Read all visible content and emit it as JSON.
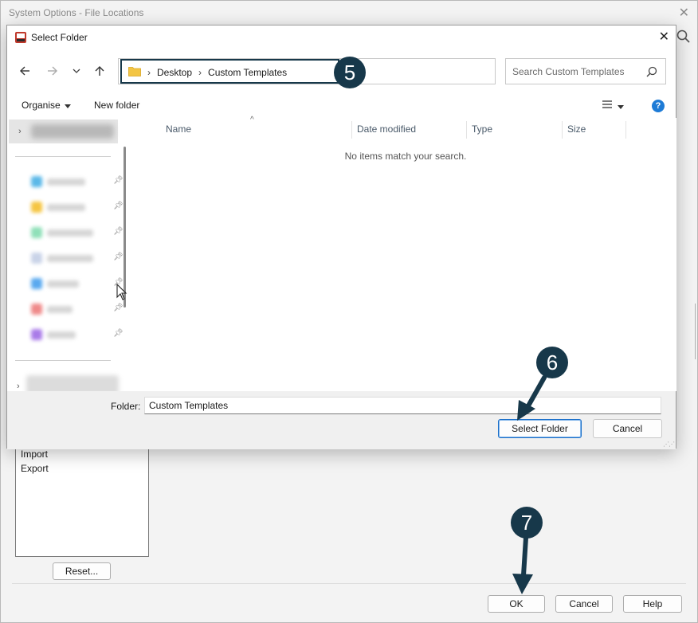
{
  "background_window": {
    "title": "System Options - File Locations",
    "list_items": [
      "Import",
      "Export"
    ],
    "reset_label": "Reset...",
    "ok_label": "OK",
    "cancel_label": "Cancel",
    "help_label": "Help"
  },
  "dialog": {
    "title": "Select Folder",
    "breadcrumbs": [
      "Desktop",
      "Custom Templates"
    ],
    "search_placeholder": "Search Custom Templates",
    "toolbar": {
      "organise_label": "Organise",
      "new_folder_label": "New folder"
    },
    "columns": [
      "Name",
      "Date modified",
      "Type",
      "Size"
    ],
    "empty_message": "No items match your search.",
    "folder_label": "Folder:",
    "folder_value": "Custom Templates",
    "select_folder_label": "Select Folder",
    "cancel_label": "Cancel",
    "quick_access_colors": [
      "#5bb8e8",
      "#f5c542",
      "#8fe0b8",
      "#c9d3e8",
      "#5aa9ef",
      "#ef8a8a",
      "#a97be8"
    ]
  },
  "annotations": {
    "step_numbers": [
      "5",
      "6",
      "7"
    ],
    "badge_color": "#17384a"
  }
}
